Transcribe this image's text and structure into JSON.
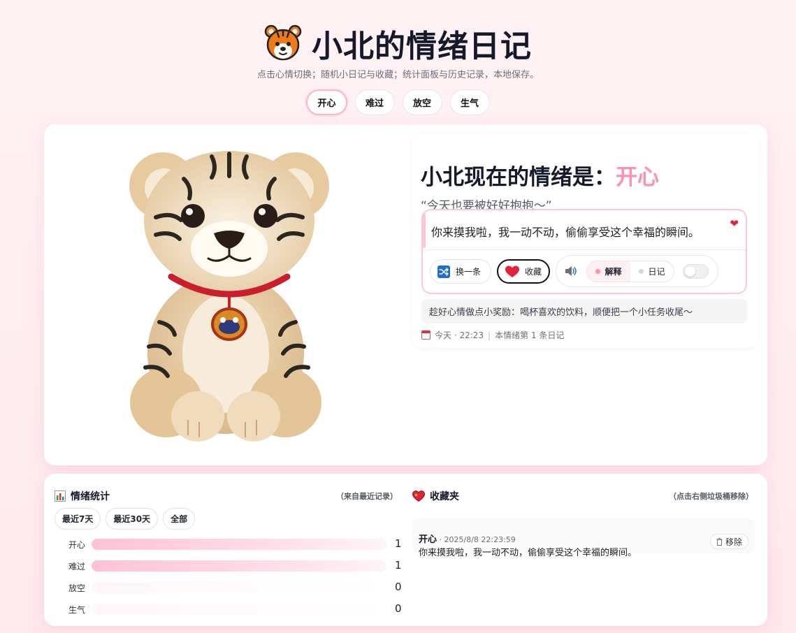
{
  "header": {
    "title": "小北的情绪日记",
    "subtitle": "点击心情切换；随机小日记与收藏；统计面板与历史记录，本地保存。",
    "logo_icon": "tiger-face-icon"
  },
  "moods": [
    {
      "label": "开心",
      "active": true
    },
    {
      "label": "难过",
      "active": false
    },
    {
      "label": "放空",
      "active": false
    },
    {
      "label": "生气",
      "active": false
    }
  ],
  "current": {
    "title_prefix": "小北现在的情绪是：",
    "mood": "开心",
    "quote": "“今天也要被好好抱抱～”",
    "diary": "你来摸我啦，我一动不动，偷偷享受这个幸福的瞬间。",
    "shuffle_label": "换一条",
    "favorite_label": "收藏",
    "explain_label": "解释",
    "diary_label": "日记",
    "tip": "趁好心情做点小奖励：喝杯喜欢的饮料，顺便把一个小任务收尾～",
    "meta_time": "今天 · 22:23",
    "meta_count": "本情绪第 1 条日记",
    "toggle_on": false
  },
  "stats": {
    "title": "情绪统计",
    "note": "（来自最近记录）",
    "ranges": [
      "最近7天",
      "最近30天",
      "全部"
    ],
    "rows": [
      {
        "label": "开心",
        "count": "1",
        "fraction": 1.0
      },
      {
        "label": "难过",
        "count": "1",
        "fraction": 1.0
      },
      {
        "label": "放空",
        "count": "0",
        "fraction": 0
      },
      {
        "label": "生气",
        "count": "0",
        "fraction": 0
      }
    ]
  },
  "favorites": {
    "title": "收藏夹",
    "note": "（点击右侧垃圾桶移除）",
    "items": [
      {
        "mood": "开心",
        "time": " · 2025/8/8 22:23:59",
        "text": "你来摸我啦，我一动不动，偷偷享受这个幸福的瞬间。",
        "remove_label": "移除"
      }
    ]
  },
  "colors": {
    "accent": "#ff8fb3",
    "accent_soft": "#ffc7d6",
    "heart": "#e0233a"
  }
}
